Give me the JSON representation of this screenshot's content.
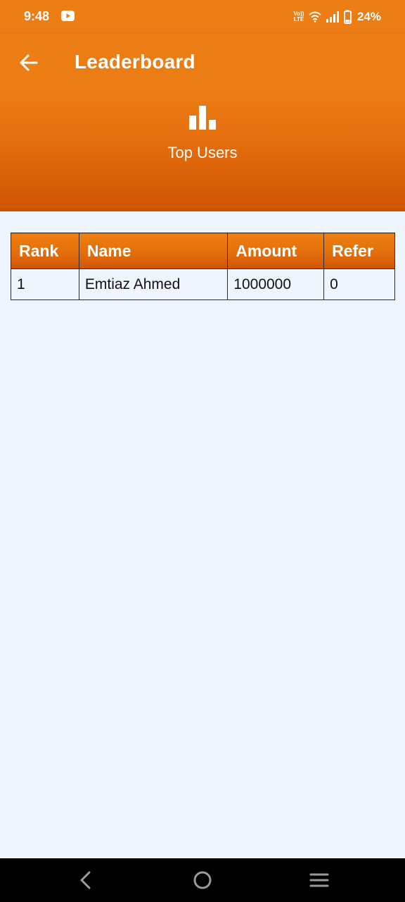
{
  "status_bar": {
    "time": "9:48",
    "battery": "24%",
    "volte_line1": "Vo))",
    "volte_line2": "LTE"
  },
  "app_bar": {
    "title": "Leaderboard"
  },
  "banner": {
    "caption": "Top Users"
  },
  "leaderboard": {
    "columns": [
      "Rank",
      "Name",
      "Amount",
      "Refer"
    ],
    "rows": [
      [
        "1",
        "Emtiaz Ahmed",
        "1000000",
        "0"
      ]
    ]
  },
  "colors": {
    "primary": "#ec7c14",
    "banner_dark": "#cf5202",
    "background": "#eef5fd"
  }
}
